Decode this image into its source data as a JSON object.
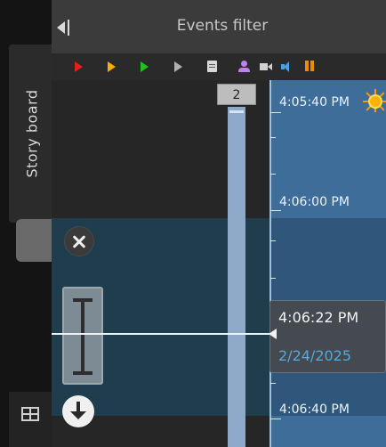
{
  "sidebar": {
    "tab_label": "Story board",
    "bottom_icon": "grid-icon"
  },
  "header": {
    "title": "Events filter",
    "collapse_icon": "collapse-left-icon"
  },
  "toolbar": {
    "icons": [
      {
        "name": "red-play-icon",
        "color": "#e02020"
      },
      {
        "name": "yellow-play-icon",
        "color": "#f0b000"
      },
      {
        "name": "green-play-icon",
        "color": "#20c020"
      },
      {
        "name": "gray-play-icon",
        "color": "#b0b0b0"
      },
      {
        "name": "document-icon",
        "color": "#d8d8d8"
      },
      {
        "name": "person-icon",
        "color": "#c080f0"
      },
      {
        "name": "camera-icon",
        "color": "#d0d0d0"
      },
      {
        "name": "speaker-icon",
        "color": "#4aa0e8"
      },
      {
        "name": "pause-icon",
        "color": "#f08a00"
      }
    ]
  },
  "storyboard": {
    "count": "2"
  },
  "timeline": {
    "labels": [
      "4:05:40 PM",
      "4:06:00 PM",
      "4:06:40 PM"
    ],
    "accent": "#3e6d99"
  },
  "cursor": {
    "time": "4:06:22 PM",
    "date": "2/24/2025"
  },
  "controls": {
    "close_icon": "close-icon",
    "bracket_icon": "i-beam-bracket-icon",
    "download_icon": "download-icon",
    "sun_icon": "sun-icon"
  }
}
